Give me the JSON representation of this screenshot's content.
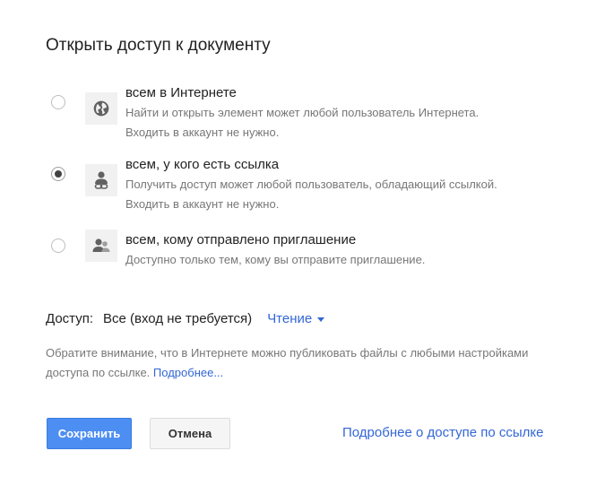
{
  "dialog": {
    "title": "Открыть доступ к документу"
  },
  "options": [
    {
      "label": "всем в Интернете",
      "desc1": "Найти и открыть элемент может любой пользователь Интернета.",
      "desc2": "Входить в аккаунт не нужно.",
      "icon": "globe-icon",
      "selected": false
    },
    {
      "label": "всем, у кого есть ссылка",
      "desc1": "Получить доступ может любой пользователь, обладающий ссылкой.",
      "desc2": "Входить в аккаунт не нужно.",
      "icon": "person-link-icon",
      "selected": true
    },
    {
      "label": "всем, кому отправлено приглашение",
      "desc1": "Доступно только тем, кому вы отправите приглашение.",
      "icon": "people-icon",
      "selected": false
    }
  ],
  "access": {
    "label": "Доступ:",
    "value": "Все (вход не требуется)",
    "level": "Чтение"
  },
  "notice": {
    "text": "Обратите внимание, что в Интернете можно публиковать файлы с любыми настройками доступа по ссылке.",
    "link": "Подробнее..."
  },
  "buttons": {
    "save": "Сохранить",
    "cancel": "Отмена"
  },
  "footer": {
    "link": "Подробнее о доступе по ссылке"
  },
  "colors": {
    "accent": "#3367d6",
    "primary_button": "#4d8ef2",
    "secondary_text": "#777777"
  }
}
